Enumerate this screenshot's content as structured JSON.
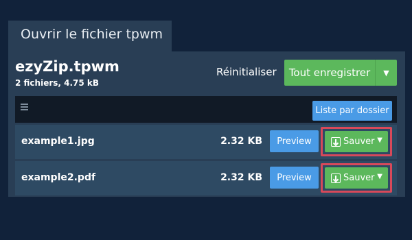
{
  "tab": {
    "title": "Ouvrir le fichier tpwm"
  },
  "archive": {
    "name": "ezyZip.tpwm",
    "info": "2 fichiers, 4.75 kB"
  },
  "header": {
    "reset_label": "Réinitialiser",
    "save_all_label": "Tout enregistrer",
    "caret": "▼"
  },
  "toolbar": {
    "menu_icon": "hamburger-icon",
    "list_label": "Liste par dossier"
  },
  "files": [
    {
      "name": "example1.jpg",
      "size": "2.32 KB",
      "preview_label": "Preview",
      "save_label": "Sauver",
      "caret": "▼"
    },
    {
      "name": "example2.pdf",
      "size": "2.32 KB",
      "preview_label": "Preview",
      "save_label": "Sauver",
      "caret": "▼"
    }
  ],
  "colors": {
    "background": "#11223a",
    "panel": "#293e55",
    "green": "#5cb85c",
    "blue": "#4a9be6",
    "highlight": "#d8495a"
  }
}
